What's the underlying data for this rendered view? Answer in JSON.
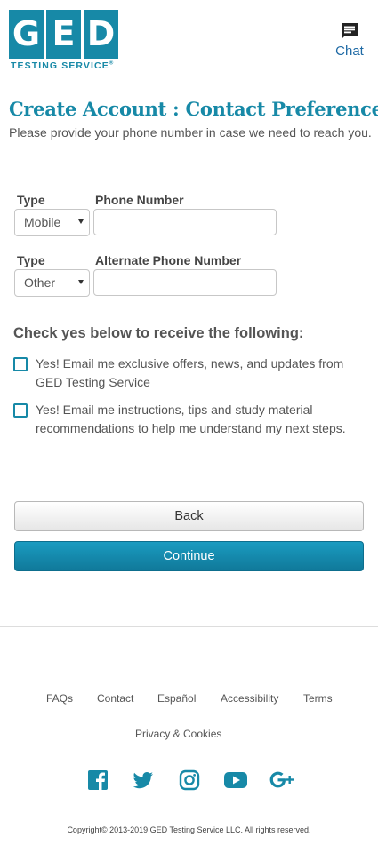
{
  "header": {
    "logo": {
      "letters": [
        "G",
        "E",
        "D"
      ],
      "subtitle": "TESTING SERVICE",
      "mark": "®"
    },
    "chat": {
      "label": "Chat",
      "icon": "chat-icon"
    }
  },
  "main": {
    "title": "Create Account : Contact Preferences",
    "intro": "Please provide your phone number in case we need to reach you.",
    "phone": {
      "type_label": "Type",
      "type_value": "Mobile",
      "number_label": "Phone Number",
      "number_value": ""
    },
    "alternate_phone": {
      "type_label": "Type",
      "type_value": "Other",
      "number_label": "Alternate Phone Number",
      "number_value": ""
    },
    "checks": {
      "heading": "Check yes below to receive the following:",
      "items": [
        {
          "label": "Yes! Email me exclusive offers, news, and updates from GED Testing Service",
          "checked": false
        },
        {
          "label": "Yes! Email me instructions, tips and study material recommendations to help me understand my next steps.",
          "checked": false
        }
      ]
    },
    "buttons": {
      "back": "Back",
      "continue": "Continue"
    }
  },
  "footer": {
    "links": [
      "FAQs",
      "Contact",
      "Español",
      "Accessibility",
      "Terms",
      "Privacy & Cookies"
    ],
    "social_icons": [
      "facebook-icon",
      "twitter-icon",
      "instagram-icon",
      "youtube-icon",
      "google-plus-icon"
    ],
    "copyright": "Copyright© 2013-2019 GED Testing Service LLC. All rights reserved."
  },
  "colors": {
    "brand": "#1789a7",
    "link": "#1f6aa5",
    "button_primary": "#1789a7"
  }
}
